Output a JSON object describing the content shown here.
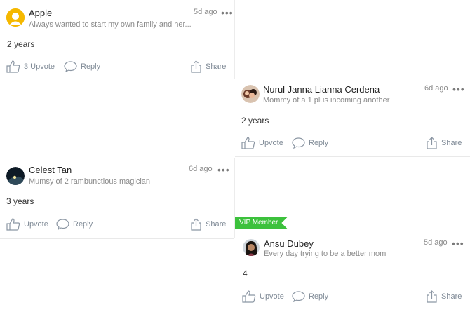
{
  "colors": {
    "vip_badge": "#3cc13c",
    "action_text": "#7f8a96",
    "meta_text": "#8a8a8a"
  },
  "vip_label": "VIP Member",
  "posts": [
    {
      "name": "Apple",
      "bio": "Always wanted to start my own family and her...",
      "time": "5d ago",
      "answer": "2 years",
      "upvote": "3 Upvote",
      "reply": "Reply",
      "share": "Share",
      "avatar_icon": "smiley-avatar-icon"
    },
    {
      "name": "Nurul Janna Lianna Cerdena",
      "bio": "Mommy of a 1 plus incoming another",
      "time": "6d ago",
      "answer": "2 years",
      "upvote": "Upvote",
      "reply": "Reply",
      "share": "Share",
      "avatar_icon": "photo-avatar-icon"
    },
    {
      "name": "Celest Tan",
      "bio": "Mumsy of 2 rambunctious magician",
      "time": "6d ago",
      "answer": "3 years",
      "upvote": "Upvote",
      "reply": "Reply",
      "share": "Share",
      "avatar_icon": "night-photo-avatar-icon"
    },
    {
      "name": "Ansu Dubey",
      "bio": "Every day trying to be a better mom",
      "time": "5d ago",
      "answer": "4",
      "upvote": "Upvote",
      "reply": "Reply",
      "share": "Share",
      "avatar_icon": "photo-avatar-icon"
    }
  ]
}
